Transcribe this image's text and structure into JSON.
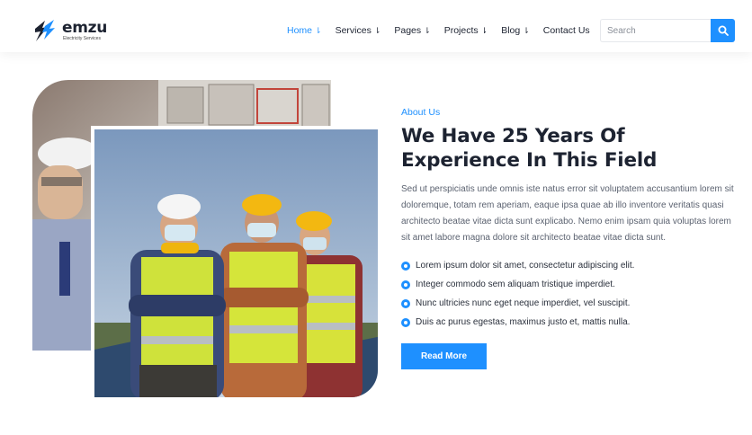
{
  "brand": {
    "name": "emzu",
    "tagline": "Electricity Services"
  },
  "nav": {
    "items": [
      {
        "label": "Home",
        "arrow": "⇂",
        "active": true
      },
      {
        "label": "Services",
        "arrow": "⇂"
      },
      {
        "label": "Pages",
        "arrow": "⇂"
      },
      {
        "label": "Projects",
        "arrow": "⇂"
      },
      {
        "label": "Blog",
        "arrow": "⇂"
      },
      {
        "label": "Contact Us",
        "arrow": ""
      }
    ]
  },
  "search": {
    "placeholder": "Search",
    "icon": "search-icon"
  },
  "about": {
    "eyebrow": "About Us",
    "heading": "We Have 25 Years Of Experience In This Field",
    "paragraph": "Sed ut perspiciatis unde omnis iste natus error sit voluptatem accusantium lorem sit doloremque, totam rem aperiam, eaque ipsa quae ab illo inventore veritatis quasi architecto beatae vitae dicta sunt explicabo. Nemo enim ipsam quia voluptas lorem sit amet labore magna dolore sit architecto beatae vitae dicta sunt.",
    "list": [
      "Lorem ipsum dolor sit amet, consectetur adipiscing elit.",
      "Integer commodo sem aliquam tristique imperdiet.",
      "Nunc ultricies nunc eget neque imperdiet, vel suscipit.",
      "Duis ac purus egestas, maximus justo et, mattis nulla."
    ],
    "button": "Read More"
  },
  "colors": {
    "accent": "#1e90ff",
    "heading": "#1d2331",
    "body": "#5b6270"
  },
  "images": {
    "back": "photo-engineer-electrical-panel",
    "front": "photo-three-workers-safety-vests"
  }
}
